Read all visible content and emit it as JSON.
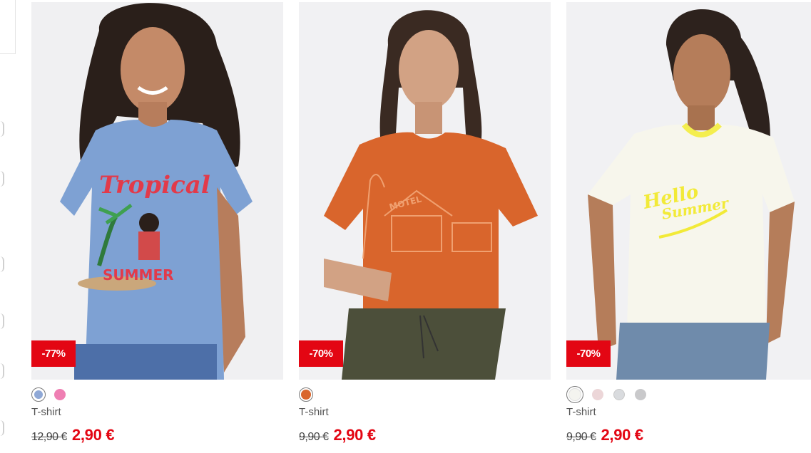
{
  "products": [
    {
      "name": "T-shirt",
      "discount": "-77%",
      "old_price": "12,90 €",
      "new_price": "2,90 €",
      "image_icon": "model-blue-tropical-summer-tshirt-photo",
      "swatches": [
        {
          "color": "#8fa8d6",
          "selected": true
        },
        {
          "color": "#ef7fb3",
          "selected": false
        }
      ]
    },
    {
      "name": "T-shirt",
      "discount": "-70%",
      "old_price": "9,90 €",
      "new_price": "2,90 €",
      "image_icon": "model-orange-motel-print-tshirt-photo",
      "swatches": [
        {
          "color": "#d9652c",
          "selected": true
        }
      ]
    },
    {
      "name": "T-shirt",
      "discount": "-70%",
      "old_price": "9,90 €",
      "new_price": "2,90 €",
      "image_icon": "model-white-hello-summer-tshirt-photo",
      "swatches": [
        {
          "color": "#f4f4ef",
          "selected": true
        },
        {
          "color": "#ecd6d8",
          "selected": false
        },
        {
          "color": "#d9dbde",
          "selected": false
        },
        {
          "color": "#c9c9cb",
          "selected": false
        }
      ]
    }
  ],
  "image_prints": {
    "p0_line1": "Tropical",
    "p0_line2": "SUMMER",
    "p1_line1": "MOTEL",
    "p2_line1": "Hello",
    "p2_line2": "Summer"
  },
  "colors": {
    "accent": "#e30613",
    "text": "#555555"
  }
}
